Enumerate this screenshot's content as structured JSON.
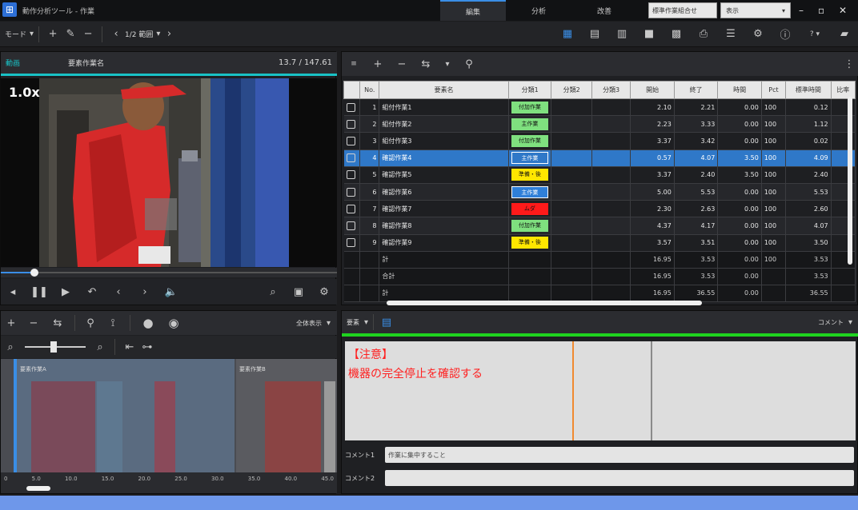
{
  "window": {
    "app_title": "動作分析ツール - 作業",
    "tabs": [
      "編集",
      "分析",
      "改善"
    ],
    "active_tab": 0,
    "combo1": "標準作業組合せ",
    "combo2": "表示"
  },
  "toolbar": {
    "mode_label": "モード",
    "range_label": "1/2 範囲"
  },
  "video": {
    "tab_label": "動画",
    "file_label": "要素作業名",
    "time": "13.7 / 147.61",
    "speed": "1.0x",
    "seek_fraction": 0.1
  },
  "table": {
    "headers": [
      "",
      "No.",
      "要素名",
      "分類1",
      "分類2",
      "分類3",
      "開始",
      "終了",
      "時間",
      "Pct",
      "標準時間",
      "比率"
    ],
    "rows": [
      {
        "no": "1",
        "name": "組付作業1",
        "cat": "付加作業",
        "cat_color": "#7fe07f",
        "start": "2.10",
        "end": "2.21",
        "time": "0.00",
        "pct": "100",
        "std": "0.12"
      },
      {
        "no": "2",
        "name": "組付作業2",
        "cat": "主作業",
        "cat_color": "#7fe07f",
        "start": "2.23",
        "end": "3.33",
        "time": "0.00",
        "pct": "100",
        "std": "1.12"
      },
      {
        "no": "3",
        "name": "組付作業3",
        "cat": "付加作業",
        "cat_color": "#7fe07f",
        "start": "3.37",
        "end": "3.42",
        "time": "0.00",
        "pct": "100",
        "std": "0.02"
      },
      {
        "no": "4",
        "name": "確認作業4",
        "cat": "主作業",
        "cat_color": "#2f78c8",
        "start": "0.57",
        "end": "4.07",
        "time": "3.50",
        "pct": "100",
        "std": "4.09"
      },
      {
        "no": "5",
        "name": "確認作業5",
        "cat": "準備・後",
        "cat_color": "#ffe600",
        "start": "3.37",
        "end": "2.40",
        "time": "3.50",
        "pct": "100",
        "std": "2.40"
      },
      {
        "no": "6",
        "name": "確認作業6",
        "cat": "主作業",
        "cat_color": "#2f7fd8",
        "start": "5.00",
        "end": "5.53",
        "time": "0.00",
        "pct": "100",
        "std": "5.53"
      },
      {
        "no": "7",
        "name": "確認作業7",
        "cat": "ムダ",
        "cat_color": "#ff1a1a",
        "start": "2.30",
        "end": "2.63",
        "time": "0.00",
        "pct": "100",
        "std": "2.60"
      },
      {
        "no": "8",
        "name": "確認作業8",
        "cat": "付加作業",
        "cat_color": "#7fe07f",
        "start": "4.37",
        "end": "4.17",
        "time": "0.00",
        "pct": "100",
        "std": "4.07"
      },
      {
        "no": "9",
        "name": "確認作業9",
        "cat": "準備・後",
        "cat_color": "#ffe600",
        "start": "3.57",
        "end": "3.51",
        "time": "0.00",
        "pct": "100",
        "std": "3.50"
      }
    ],
    "summary": [
      {
        "label": "計",
        "a": "16.95",
        "b": "3.53",
        "c": "0.00",
        "d": "100",
        "e": "3.53"
      },
      {
        "label": "合計",
        "a": "16.95",
        "b": "3.53",
        "c": "0.00",
        "d": "",
        "e": "3.53"
      },
      {
        "label": "計",
        "a": "16.95",
        "b": "36.55",
        "c": "0.00",
        "d": "",
        "e": "36.55"
      }
    ]
  },
  "timeline": {
    "zoom_label": "全体表示",
    "segment1_label": "要素作業A",
    "segment2_label": "要素作業B",
    "ruler_ticks": [
      "0",
      "5.0",
      "10.0",
      "15.0",
      "20.0",
      "25.0",
      "30.0",
      "35.0",
      "40.0",
      "45.0"
    ]
  },
  "notes": {
    "mode_label": "要素",
    "right_label": "コメント",
    "title": "【注意】",
    "body": "機器の完全停止を確認する",
    "comment1_label": "コメント1",
    "comment1_value": "作業に集中すること",
    "comment2_label": "コメント2",
    "comment2_value": ""
  },
  "colors": {
    "accent": "#2f78c8",
    "video_line": "#19c2c6",
    "notes_line": "#1fd41f",
    "note_text": "#ff2020"
  }
}
